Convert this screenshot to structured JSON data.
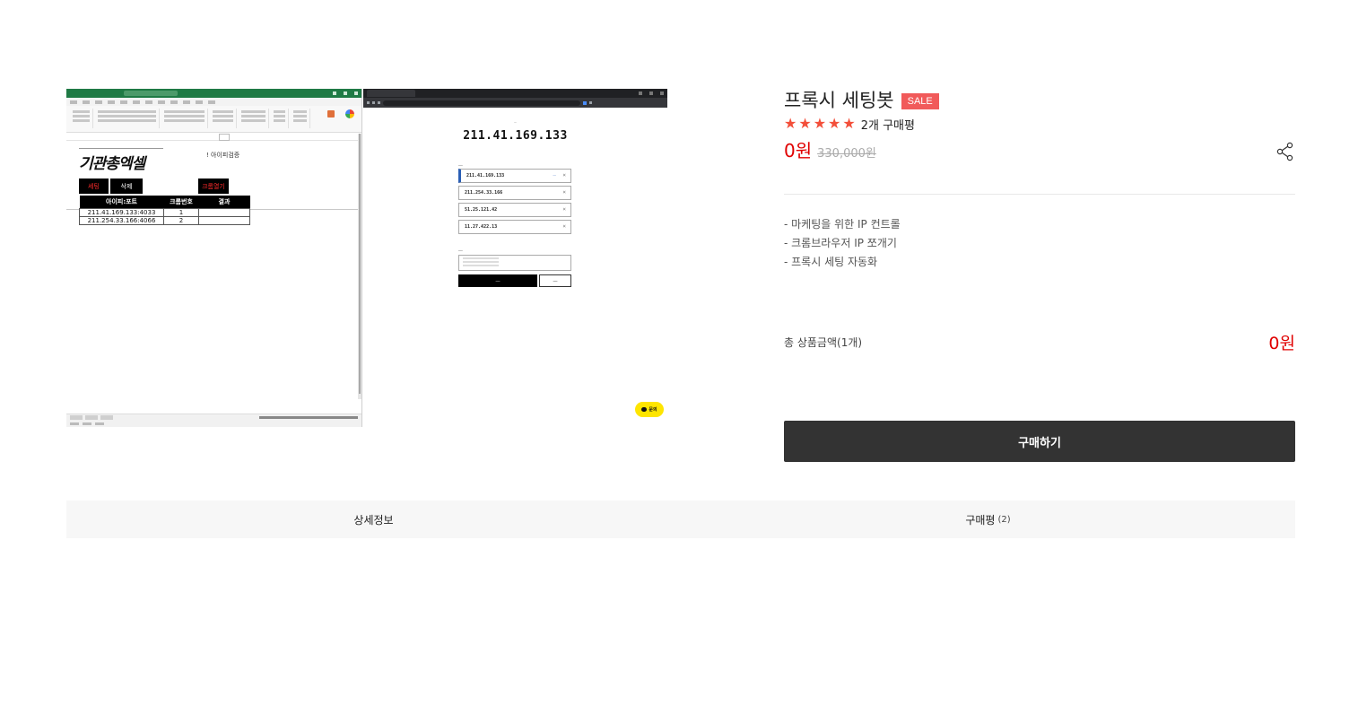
{
  "product": {
    "title": "프록시 세팅봇",
    "badge": "SALE",
    "rating_stars": 5,
    "review_summary": "2개 구매평",
    "price": "0원",
    "original_price": "330,000원",
    "features": [
      "- 마케팅을 위한 IP 컨트롤",
      "- 크롬브라우저 IP 쪼개기",
      "- 프록시 세팅 자동화"
    ],
    "total_label": "총 상품금액(1개)",
    "total_value": "0원",
    "buy_label": "구매하기"
  },
  "tabs": [
    {
      "label": "상세정보",
      "count": ""
    },
    {
      "label": "구매평",
      "count": "(2)"
    }
  ],
  "image": {
    "excel": {
      "logo": "기관총엑셀",
      "note": "! 아이피검증",
      "buttons": [
        "세팅",
        "삭제",
        "크롬열기"
      ],
      "columns": [
        "아이피:포트",
        "크롬번호",
        "결과"
      ],
      "rows": [
        [
          "211.41.169.133:4033",
          "1",
          ""
        ],
        [
          "211.254.33.166:4066",
          "2",
          ""
        ]
      ]
    },
    "browser": {
      "current_ip": "211.41.169.133",
      "ip_list": [
        "211.41.169.133",
        "211.254.33.166",
        "51.25.121.42",
        "11.27.422.13"
      ],
      "chat_label": "문의"
    }
  },
  "colors": {
    "sale_badge": "#f15a5a",
    "price": "#e00000",
    "star": "#f34f3a",
    "buy_button": "#333333",
    "excel_green": "#1f7a45",
    "kakao_yellow": "#fee500"
  }
}
